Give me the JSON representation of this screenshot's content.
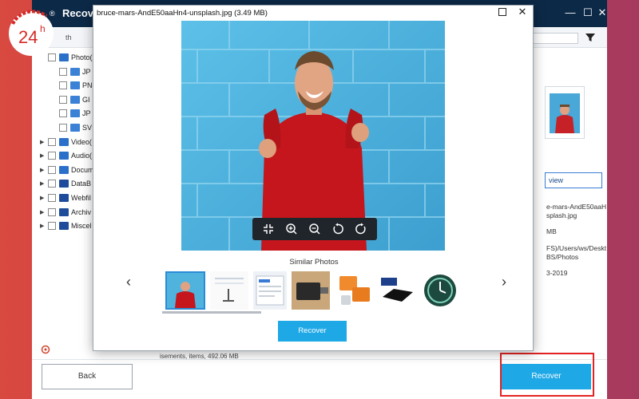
{
  "app": {
    "title": "Recove",
    "path_label": "th",
    "tree": [
      {
        "label": "Photo(",
        "arrow": "",
        "checked": false,
        "indent": 0,
        "color": "#2a6fc9"
      },
      {
        "label": "JP",
        "arrow": "",
        "checked": false,
        "indent": 1,
        "color": "#3b82d6"
      },
      {
        "label": "PN",
        "arrow": "",
        "checked": false,
        "indent": 1,
        "color": "#3b82d6"
      },
      {
        "label": "GI",
        "arrow": "",
        "checked": false,
        "indent": 1,
        "color": "#3b82d6"
      },
      {
        "label": "JP",
        "arrow": "",
        "checked": false,
        "indent": 1,
        "color": "#3b82d6"
      },
      {
        "label": "SV",
        "arrow": "",
        "checked": false,
        "indent": 1,
        "color": "#3b82d6"
      },
      {
        "label": "Video(",
        "arrow": "▶",
        "checked": false,
        "indent": 0,
        "color": "#2a6fc9"
      },
      {
        "label": "Audio(",
        "arrow": "▶",
        "checked": false,
        "indent": 0,
        "color": "#2a6fc9"
      },
      {
        "label": "Docum",
        "arrow": "▶",
        "checked": false,
        "indent": 0,
        "color": "#2a6fc9"
      },
      {
        "label": "DataB",
        "arrow": "▶",
        "checked": false,
        "indent": 0,
        "color": "#1f4c9a"
      },
      {
        "label": "Webfil",
        "arrow": "▶",
        "checked": false,
        "indent": 0,
        "color": "#1f4c9a"
      },
      {
        "label": "Archiv",
        "arrow": "▶",
        "checked": false,
        "indent": 0,
        "color": "#1f4c9a"
      },
      {
        "label": "Miscel",
        "arrow": "▶",
        "checked": false,
        "indent": 0,
        "color": "#1f4c9a"
      }
    ],
    "right_panel": {
      "preview_label": "view",
      "filename_line1": "e-mars-AndE50aaH",
      "filename_line2": "splash.jpg",
      "size": "MB",
      "path_line1": "FS)/Users/ws/Deskt",
      "path_line2": "BS/Photos",
      "date": "3-2019"
    },
    "status_items": "isements, items, 492.06 MB",
    "back_label": "Back",
    "recover_label": "Recover"
  },
  "modal": {
    "title": "bruce-mars-AndE50aaHn4-unsplash.jpg (3.49  MB)",
    "similar_label": "Similar Photos",
    "recover_label": "Recover",
    "prev_icon": "‹",
    "next_icon": "›",
    "close_icon": "✕"
  },
  "logo": {
    "text": "24",
    "superscript": "h",
    "registered": "®"
  },
  "colors": {
    "accent": "#1ea8e6",
    "titlebar": "#0c2947",
    "highlight_frame": "#e32222"
  }
}
